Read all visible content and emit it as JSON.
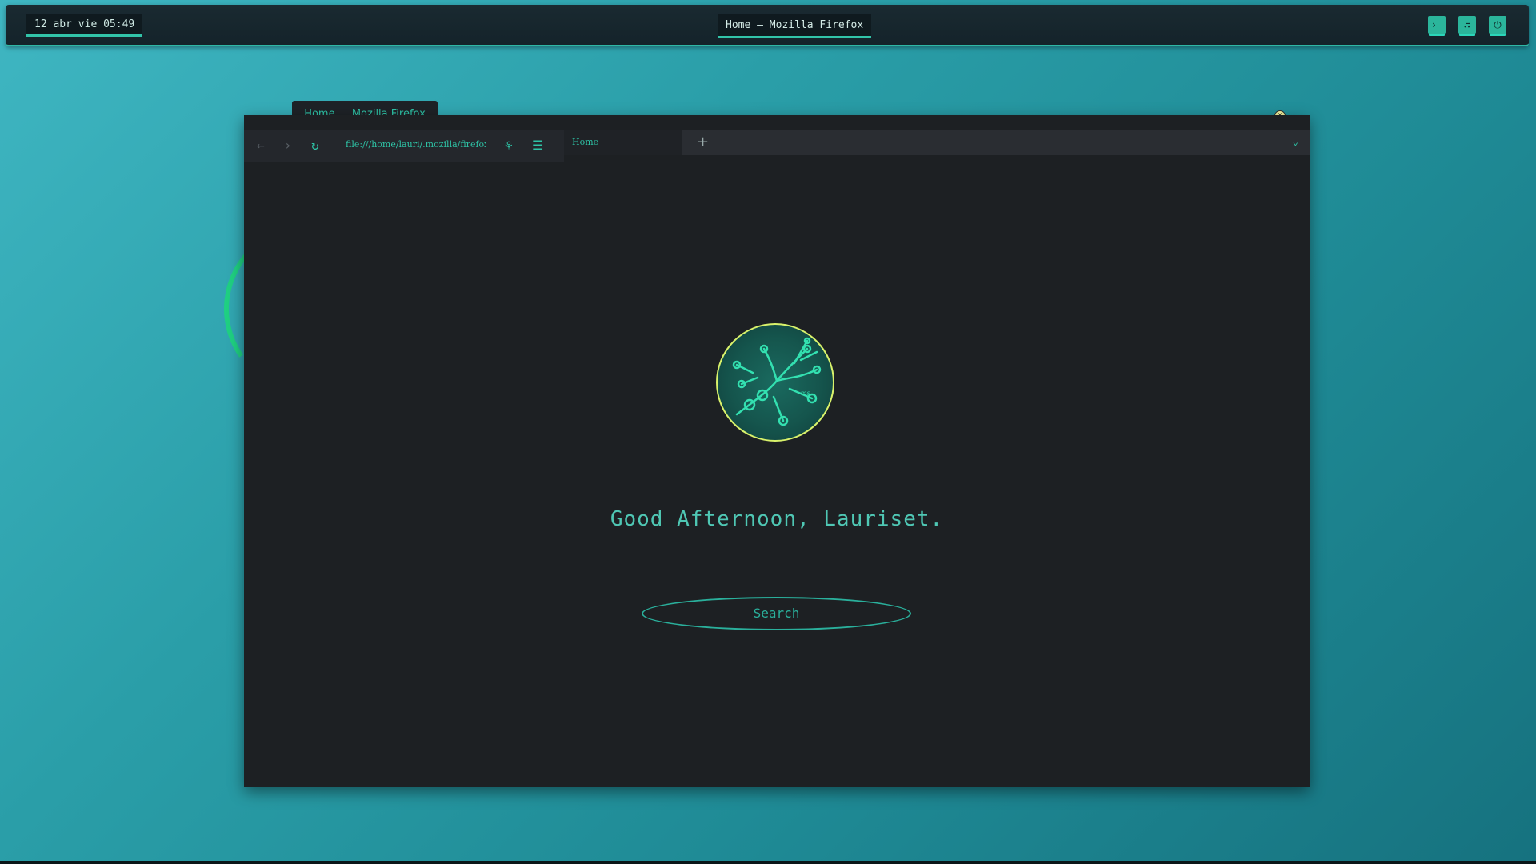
{
  "panel": {
    "clock": "12 abr vie 05:49",
    "active_window_title": "Home — Mozilla Firefox",
    "buttons": [
      {
        "icon": "terminal-icon",
        "glyph": "›_"
      },
      {
        "icon": "music-icon",
        "glyph": "♬"
      },
      {
        "icon": "power-icon",
        "glyph": "⏻"
      }
    ]
  },
  "window": {
    "title": "Home — Mozilla Firefox",
    "url": "file:///home/lauri/.mozilla/firefox/",
    "tab_label": "Home",
    "new_tab_glyph": "+",
    "tab_menu_glyph": "⌄"
  },
  "page": {
    "greeting": "Good Afternoon, Lauriset.",
    "search_label": "Search"
  },
  "colors": {
    "accent": "#2ec3a6",
    "background": "#1d2023",
    "logo_ring": "#d9f26b"
  }
}
